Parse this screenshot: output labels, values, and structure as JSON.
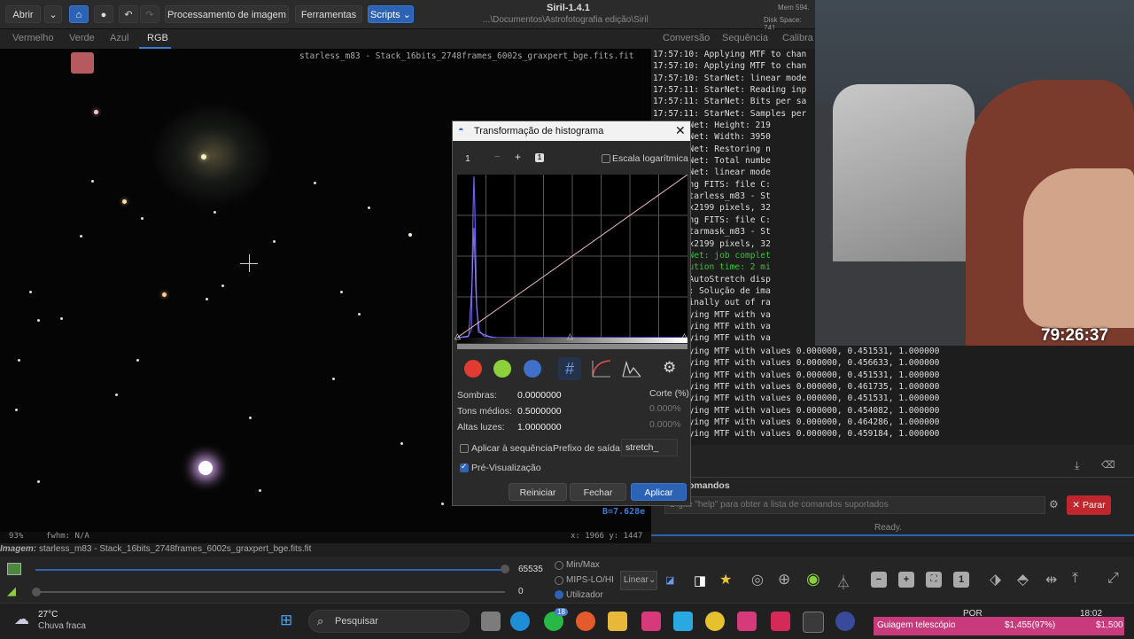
{
  "header": {
    "open_label": "Abrir",
    "image_processing_menu": "Processamento de imagem",
    "tools_menu": "Ferramentas",
    "scripts_menu": "Scripts",
    "app_title": "Siril-1.4.1",
    "path": "...\\Documentos\\Astrofotografia edição\\Siril",
    "mem": "Mem 594.",
    "disk": "Disk Space: 741."
  },
  "channel_tabs": [
    "Vermelho",
    "Verde",
    "Azul",
    "RGB"
  ],
  "image": {
    "filename_overlay": "starless_m83 - Stack_16bits_2748frames_6002s_graxpert_bge.fits.fit",
    "status_zoom": "93%",
    "status_fwhm": "fwhm: N/A",
    "status_coords": "x: 1966 y: 1447",
    "value_overlay": "B=7.628e"
  },
  "console_tabs": [
    "Conversão",
    "Sequência",
    "Calibra"
  ],
  "console_lines": [
    {
      "text": "17:57:10: Applying MTF to chan",
      "color": "normal"
    },
    {
      "text": "17:57:10: Applying MTF to chan",
      "color": "normal"
    },
    {
      "text": "17:57:10: StarNet: linear mode",
      "color": "normal"
    },
    {
      "text": "17:57:11: StarNet: Reading inp",
      "color": "normal"
    },
    {
      "text": "17:57:11: StarNet: Bits per sa",
      "color": "normal"
    },
    {
      "text": "17:57:11: StarNet: Samples per",
      "color": "normal"
    },
    {
      "text": "1: StarNet: Height: 219",
      "color": "normal"
    },
    {
      "text": "1: StarNet: Width: 3950",
      "color": "normal"
    },
    {
      "text": "2: StarNet: Restoring n",
      "color": "normal"
    },
    {
      "text": "2: StarNet: Total numbe",
      "color": "normal"
    },
    {
      "text": "2: StarNet: linear mode",
      "color": "normal"
    },
    {
      "text": "5: Saving FITS: file C:",
      "color": "normal"
    },
    {
      "text": "Siril\\starless_m83 - St",
      "color": "normal"
    },
    {
      "text": "), 3950x2199 pixels, 32",
      "color": "normal"
    },
    {
      "text": "5: Saving FITS: file C:",
      "color": "normal"
    },
    {
      "text": "Siril\\starmask_m83 - St",
      "color": "normal"
    },
    {
      "text": "), 3950x2199 pixels, 32",
      "color": "normal"
    },
    {
      "text": "5: StarNet: job complet",
      "color": "green"
    },
    {
      "text": "5: Execution time: 2 mi",
      "color": "green"
    },
    {
      "text": "4: The AutoStretch disp",
      "color": "normal"
    },
    {
      "text": "1: Undo: Solução de ima",
      "color": "normal"
    },
    {
      "text": "1: Marginally out of ra",
      "color": "normal"
    },
    {
      "text": "1: Applying MTF with va",
      "color": "normal"
    },
    {
      "text": "9: Applying MTF with va",
      "color": "normal"
    },
    {
      "text": "1: Applying MTF with va",
      "color": "normal"
    }
  ],
  "console_wide_lines": [
    "5: Applying MTF with values 0.000000, 0.451531, 1.000000",
    "5: Applying MTF with values 0.000000, 0.456633, 1.000000",
    "5: Applying MTF with values 0.000000, 0.451531, 1.000000",
    "5: Applying MTF with values 0.000000, 0.461735, 1.000000",
    "4: Applying MTF with values 0.000000, 0.451531, 1.000000",
    "9: Applying MTF with values 0.000000, 0.454082, 1.000000",
    "2: Applying MTF with values 0.000000, 0.464286, 1.000000",
    "5: Applying MTF with values 0.000000, 0.459184, 1.000000"
  ],
  "commands": {
    "label": "omandos",
    "placeholder": "Digite \"help\" para obter a lista de comandos suportados",
    "stop_label": "Parar",
    "status": "Ready."
  },
  "webcam": {
    "timer": "79:26:37"
  },
  "dialog": {
    "title": "Transformação de histograma",
    "zoom_value": "1",
    "zoom_badge": "1",
    "log_scale_label": "Escala logarítmica",
    "shadows_label": "Sombras:",
    "shadows_value": "0.0000000",
    "midtones_label": "Tons médios:",
    "midtones_value": "0.5000000",
    "highlights_label": "Altas luzes:",
    "highlights_value": "1.0000000",
    "clip_label": "Corte (%)",
    "clip_low": "0.000%",
    "clip_high": "0.000%",
    "apply_sequence_label": "Aplicar à sequência",
    "output_prefix_label": "Prefixo de saída:",
    "output_prefix_value": "stretch_",
    "preview_label": "Pré-Visualização",
    "reset_label": "Reiniciar",
    "close_label": "Fechar",
    "apply_label": "Aplicar"
  },
  "bottom": {
    "image_label": "Imagem:",
    "image_name": "starless_m83 - Stack_16bits_2748frames_6002s_graxpert_bge.fits.fit",
    "slider_max": "65535",
    "slider_min": "0",
    "mode_minmax": "Min/Max",
    "mode_mips": "MIPS-LO/HI",
    "mode_user": "Utilizador",
    "scale_select": "Linear"
  },
  "taskbar": {
    "temperature": "27°C",
    "weather": "Chuva fraca",
    "search_label": "Pesquisar",
    "whatsapp_badge": "18",
    "lang": "POR",
    "time": "18:02",
    "ticker_label": "Guiagem telescópio",
    "ticker_value": "$1,455(97%)",
    "ticker_goal": "$1,500"
  },
  "colors": {
    "accent": "#2c63b5",
    "stop_red": "#c0262d",
    "console_green": "#3cbf3c",
    "ticker_pink": "#c93a7c"
  }
}
